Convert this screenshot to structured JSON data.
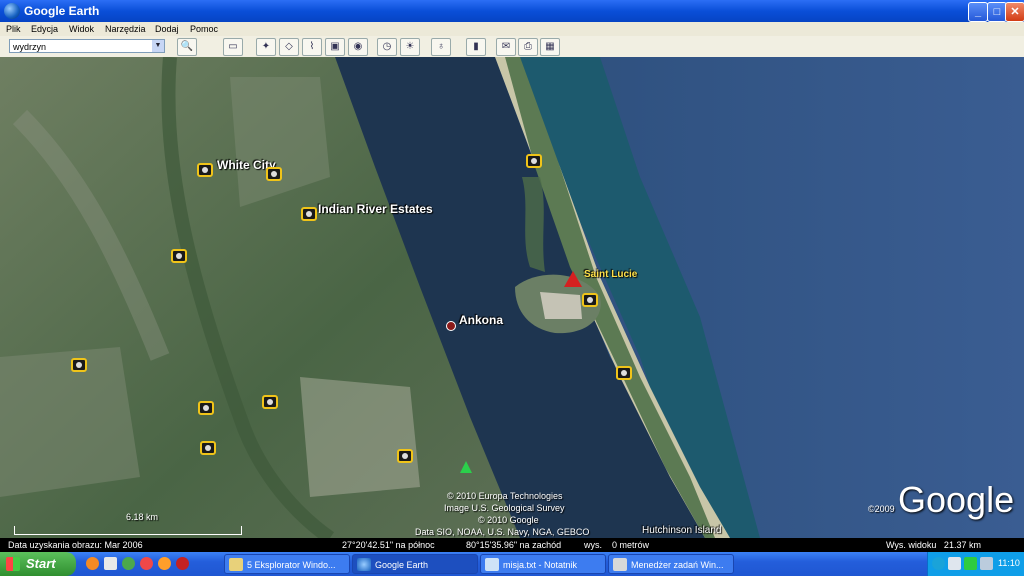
{
  "window": {
    "title": "Google Earth"
  },
  "menu": [
    "Plik",
    "Edycja",
    "Widok",
    "Narzędzia",
    "Dodaj",
    "Pomoc"
  ],
  "search": {
    "value": "wydrzyn"
  },
  "map": {
    "places": [
      {
        "name": "White City"
      },
      {
        "name": "Indian River Estates"
      },
      {
        "name": "Ankona"
      },
      {
        "name": "Saint Lucie"
      },
      {
        "name": "Hutchinson Island"
      }
    ],
    "scale": "6.18 km",
    "attribution": [
      "© 2010 Europa Technologies",
      "Image U.S. Geological Survey",
      "© 2010 Google",
      "Data SIO, NOAA, U.S. Navy, NGA, GEBCO"
    ],
    "logo": "Google",
    "logo_year": "©2009"
  },
  "status": {
    "imagery_date": "Data uzyskania obrazu: Mar 2006",
    "lat": "27°20'42.51\" na północ",
    "lon": "80°15'35.96\" na zachód",
    "elev": "wys.    0 metrów",
    "eye_alt": "Wys. widoku   21.37 km"
  },
  "taskbar": {
    "start": "Start",
    "tasks": [
      "5 Eksplorator Windo...",
      "Google Earth",
      "misja.txt - Notatnik",
      "Menedżer zadań Win..."
    ],
    "clock": "11:10"
  }
}
